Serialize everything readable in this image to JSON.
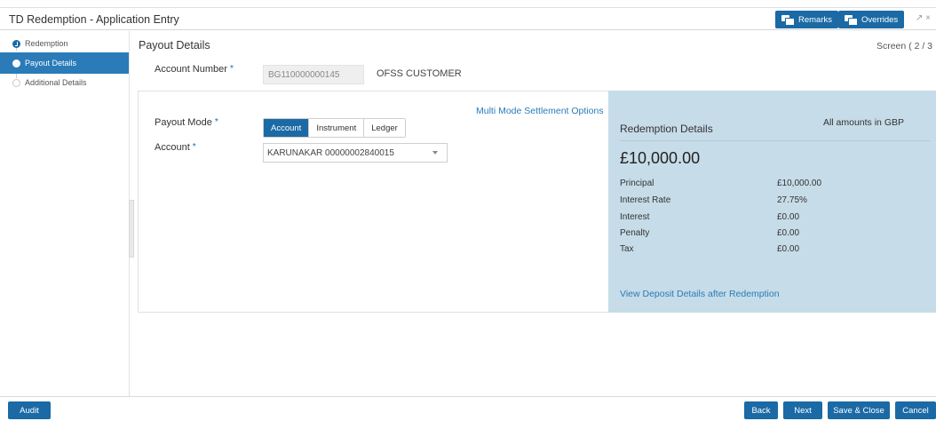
{
  "window": {
    "title": "TD Redemption - Application Entry",
    "controls": "↗ ×"
  },
  "header": {
    "remarks_label": "Remarks",
    "overrides_label": "Overrides"
  },
  "steps": [
    {
      "label": "Redemption",
      "state": "done"
    },
    {
      "label": "Payout Details",
      "state": "active"
    },
    {
      "label": "Additional Details",
      "state": "todo"
    }
  ],
  "page": {
    "section_title": "Payout Details",
    "screen_indicator": "Screen ( 2 / 3"
  },
  "account_number": {
    "label": "Account Number",
    "required": "*",
    "value": "BG110000000145",
    "customer_name": "OFSS CUSTOMER"
  },
  "payout": {
    "multi_mode_link": "Multi Mode Settlement Options",
    "mode_label": "Payout Mode",
    "mode_options": [
      "Account",
      "Instrument",
      "Ledger"
    ],
    "selected_mode": "Account",
    "account_label": "Account",
    "account_value": "KARUNAKAR 00000002840015"
  },
  "redemption": {
    "currency_note": "All amounts in GBP",
    "title": "Redemption Details",
    "total": "£10,000.00",
    "rows": [
      {
        "label": "Principal",
        "value": "£10,000.00"
      },
      {
        "label": "Interest Rate",
        "value": "27.75%"
      },
      {
        "label": "Interest",
        "value": "£0.00"
      },
      {
        "label": "Penalty",
        "value": "£0.00"
      },
      {
        "label": "Tax",
        "value": "£0.00"
      }
    ],
    "view_link": "View Deposit Details after Redemption"
  },
  "footer": {
    "audit": "Audit",
    "back": "Back",
    "next": "Next",
    "save_close": "Save & Close",
    "cancel": "Cancel"
  },
  "colors": {
    "primary": "#1b6aa5",
    "active_step": "#2a7bb8",
    "summary_bg": "#c6dce8"
  }
}
